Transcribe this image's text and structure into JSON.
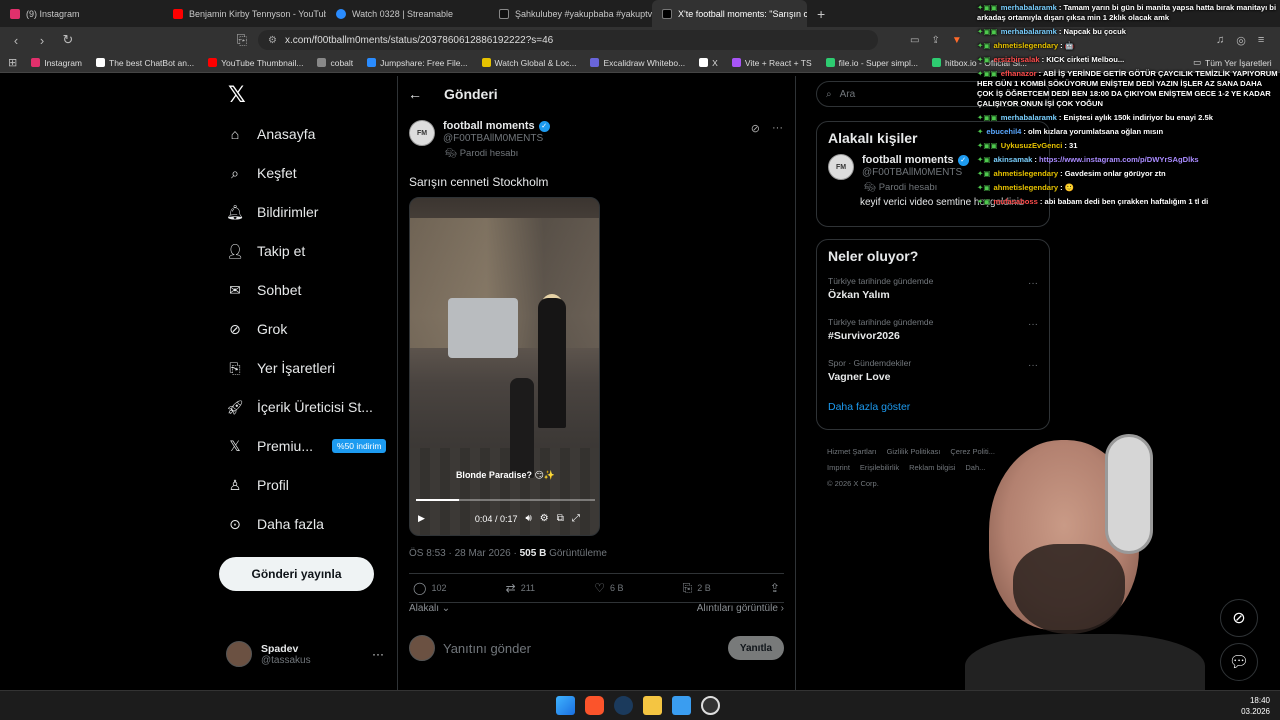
{
  "tabs": [
    {
      "label": "(9) Instagram",
      "color": "#e1306c"
    },
    {
      "label": "Benjamin Kirby Tennyson - YouTube",
      "color": "#ff0000"
    },
    {
      "label": "Watch 0328 | Streamable",
      "color": "#2a8cff"
    },
    {
      "label": "Şahkulubey #yakupbaba #yakuptv...",
      "color": "#ffffff"
    },
    {
      "label": "X'te football moments: \"Sarışın c...",
      "color": "#ffffff",
      "active": true
    }
  ],
  "address": {
    "url": "x.com/f00tballm0ments/status/2037860612886192222?s=46"
  },
  "bookmarks": [
    {
      "label": "Instagram",
      "color": "#e1306c"
    },
    {
      "label": "The best ChatBot an...",
      "color": "#ffffff"
    },
    {
      "label": "YouTube Thumbnail...",
      "color": "#ff0000"
    },
    {
      "label": "cobalt",
      "color": "#888888"
    },
    {
      "label": "Jumpshare: Free File...",
      "color": "#2a8cff"
    },
    {
      "label": "Watch Global & Loc...",
      "color": "#e6c200"
    },
    {
      "label": "Excalidraw Whitebo...",
      "color": "#6965db"
    },
    {
      "label": "X",
      "color": "#ffffff"
    },
    {
      "label": "Vite + React + TS",
      "color": "#a855f7"
    },
    {
      "label": "file.io - Super simpl...",
      "color": "#2ecc71"
    },
    {
      "label": "hitbox.io - Official Si...",
      "color": "#2ecc71"
    }
  ],
  "bookmarks_right": "Tüm Yer İşaretleri",
  "nav": {
    "home": "Anasayfa",
    "explore": "Keşfet",
    "notifications": "Bildirimler",
    "follow": "Takip et",
    "chat": "Sohbet",
    "grok": "Grok",
    "bookmarks": "Yer İşaretleri",
    "creator": "İçerik Üreticisi St...",
    "premium": "Premiu...",
    "premium_badge": "%50 indirim",
    "profile": "Profil",
    "more": "Daha fazla",
    "post_button": "Gönderi yayınla"
  },
  "me": {
    "name": "Spadev",
    "handle": "@tassakus"
  },
  "post": {
    "header": "Gönderi",
    "author_name": "football moments",
    "author_handle": "@F00TBAllM0MENTS",
    "parody_label": "Parodi hesabı",
    "text": "Sarışın cenneti Stockholm",
    "video_caption": "Blonde Paradise? 😏✨",
    "video_time": "0:04 / 0:17",
    "video_progress": 0.24,
    "timestamp": "ÖS 8:53 · 28 Mar 2026 · ",
    "views_count": "505 B",
    "views_label": " Görüntüleme",
    "replies": "102",
    "reposts": "211",
    "likes": "6 B",
    "bookmarks": "2 B",
    "sort": "Alakalı",
    "quotes_link": "Alıntıları görüntüle",
    "reply_placeholder": "Yanıtını gönder",
    "reply_button": "Yanıtla"
  },
  "search": {
    "placeholder": "Ara"
  },
  "related": {
    "title": "Alakalı kişiler",
    "name": "football moments",
    "handle": "@F00TBAllM0MENTS",
    "parody": "Parodi hesabı",
    "bio": "keyif verici video semtine hoşgeldiniz"
  },
  "trends": {
    "title": "Neler oluyor?",
    "items": [
      {
        "context": "Türkiye tarihinde gündemde",
        "name": "Özkan Yalım"
      },
      {
        "context": "Türkiye tarihinde gündemde",
        "name": "#Survivor2026"
      },
      {
        "context": "Spor · Gündemdekiler",
        "name": "Vagner Love"
      }
    ],
    "show_more": "Daha fazla göster"
  },
  "footer": [
    "Hizmet Şartları",
    "Gizlilik Politikası",
    "Çerez Politi...",
    "Imprint",
    "Erişilebilirlik",
    "Reklam bilgisi",
    "Dah...",
    "© 2026 X Corp."
  ],
  "chat": [
    {
      "user": "merhabalaramk",
      "color": "#7ad0ff",
      "text": "Tamam yarın bi gün bi manita yapsa hatta bırak manitayı bi arkadaş ortamıyla dışarı çıksa min 1 2klık olacak amk"
    },
    {
      "user": "merhabalaramk",
      "color": "#7ad0ff",
      "text": "Napcak bu çocuk"
    },
    {
      "user": "ahmetislegendary",
      "color": "#e6c200",
      "text": "🤖"
    },
    {
      "user": "ersizbirsalak",
      "color": "#ff4d4d",
      "text": "KICK cirketi Melbou..."
    },
    {
      "user": "efhanazor",
      "color": "#ff4d4d",
      "text": "ABİ İŞ YERİNDE GETİR GÖTÜR ÇAYCILIK TEMİZLİK YAPIYORUM HER GÜN 1 KOMBİ SÖKÜYORUM ENİŞTEM DEDİ YAZIN İŞLER AZ SANA DAHA ÇOK İŞ ÖĞRETCEM DEDİ BEN 18:00 DA ÇIKIYOM ENİŞTEM GECE 1-2 YE KADAR ÇALIŞIYOR ONUN İŞİ ÇOK YOĞUN"
    },
    {
      "user": "merhabalaramk",
      "color": "#7ad0ff",
      "text": "Eniştesi aylık 150k indiriyor bu enayi 2.5k"
    },
    {
      "user": "ebucehil4",
      "color": "#5aa8ff",
      "text": "olm kızlara yorumlatsana oğlan mısın"
    },
    {
      "user": "UykusuzEvGenci",
      "color": "#e6c200",
      "text": "31"
    },
    {
      "user": "akinsamak",
      "color": "#7ad0ff",
      "text": "https://www.instagram.com/p/DWYrSAgDlks"
    },
    {
      "user": "ahmetislegendary",
      "color": "#e6c200",
      "text": "Gavdesim onlar görüyor ztn"
    },
    {
      "user": "ahmetislegendary",
      "color": "#e6c200",
      "text": "🙂"
    },
    {
      "user": "mufasaboss",
      "color": "#ff4d4d",
      "text": "abi babam dedi ben çırakken haftalığım 1 tl di"
    }
  ],
  "taskbar": {
    "time": "18:40",
    "date": "03.2026",
    "icons": [
      "windows-icon",
      "brave-icon",
      "steam-icon",
      "folder-icon",
      "store-icon",
      "obs-icon"
    ]
  }
}
